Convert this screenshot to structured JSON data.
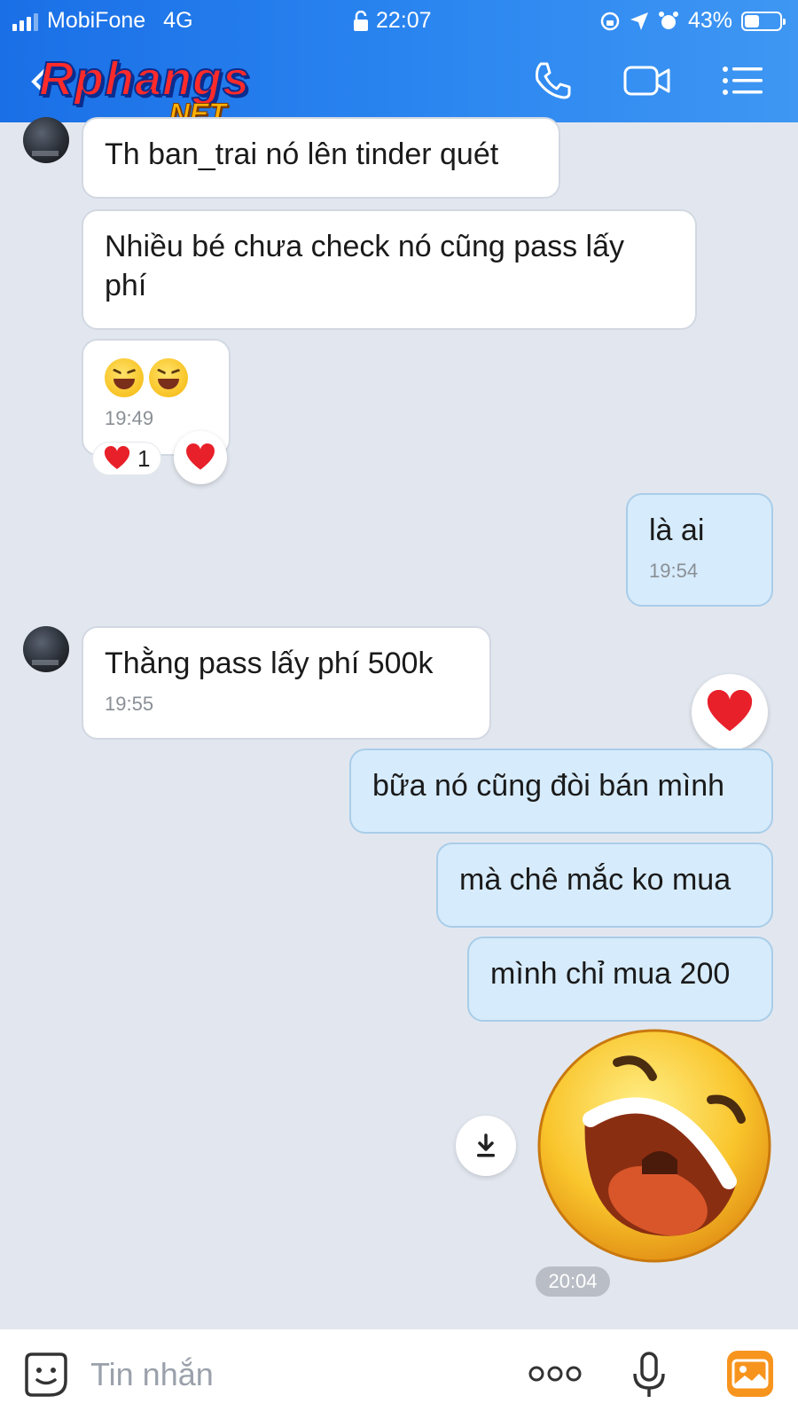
{
  "status_bar": {
    "carrier": "MobiFone",
    "network": "4G",
    "time": "22:07",
    "battery": "43%",
    "battery_level": 0.43
  },
  "header": {
    "logo_text": "Rphangs",
    "logo_suffix": ".NET",
    "icons": [
      "back-icon",
      "phone-icon",
      "video-call-icon",
      "menu-list-icon"
    ],
    "color": "#2b86f0"
  },
  "messages": [
    {
      "side": "in",
      "text": "Th ban_trai nó lên tinder quét"
    },
    {
      "side": "in",
      "text": "Nhiều bé chưa check nó cũng pass lấy phí"
    },
    {
      "side": "in",
      "emoji_count": 2,
      "time": "19:49",
      "reaction_count": "1"
    },
    {
      "side": "out",
      "text": "là ai",
      "time": "19:54"
    },
    {
      "side": "in",
      "text": "Thằng pass lấy phí 500k",
      "time": "19:55"
    },
    {
      "side": "out",
      "text": "bữa nó cũng đòi bán mình"
    },
    {
      "side": "out",
      "text": "mà chê mắc ko mua"
    },
    {
      "side": "out",
      "text": "mình chỉ mua 200"
    },
    {
      "side": "out",
      "sticker": "laughing-face-sticker",
      "time": "20:04"
    }
  ],
  "input": {
    "placeholder": "Tin nhắn",
    "icons": [
      "emoji-sticker-icon",
      "more-dots-icon",
      "microphone-icon",
      "image-gallery-icon"
    ]
  },
  "colors": {
    "background": "#e2e7ef",
    "incoming_bubble": "#ffffff",
    "outgoing_bubble": "#d6ebfb",
    "heart": "#e8202a"
  }
}
